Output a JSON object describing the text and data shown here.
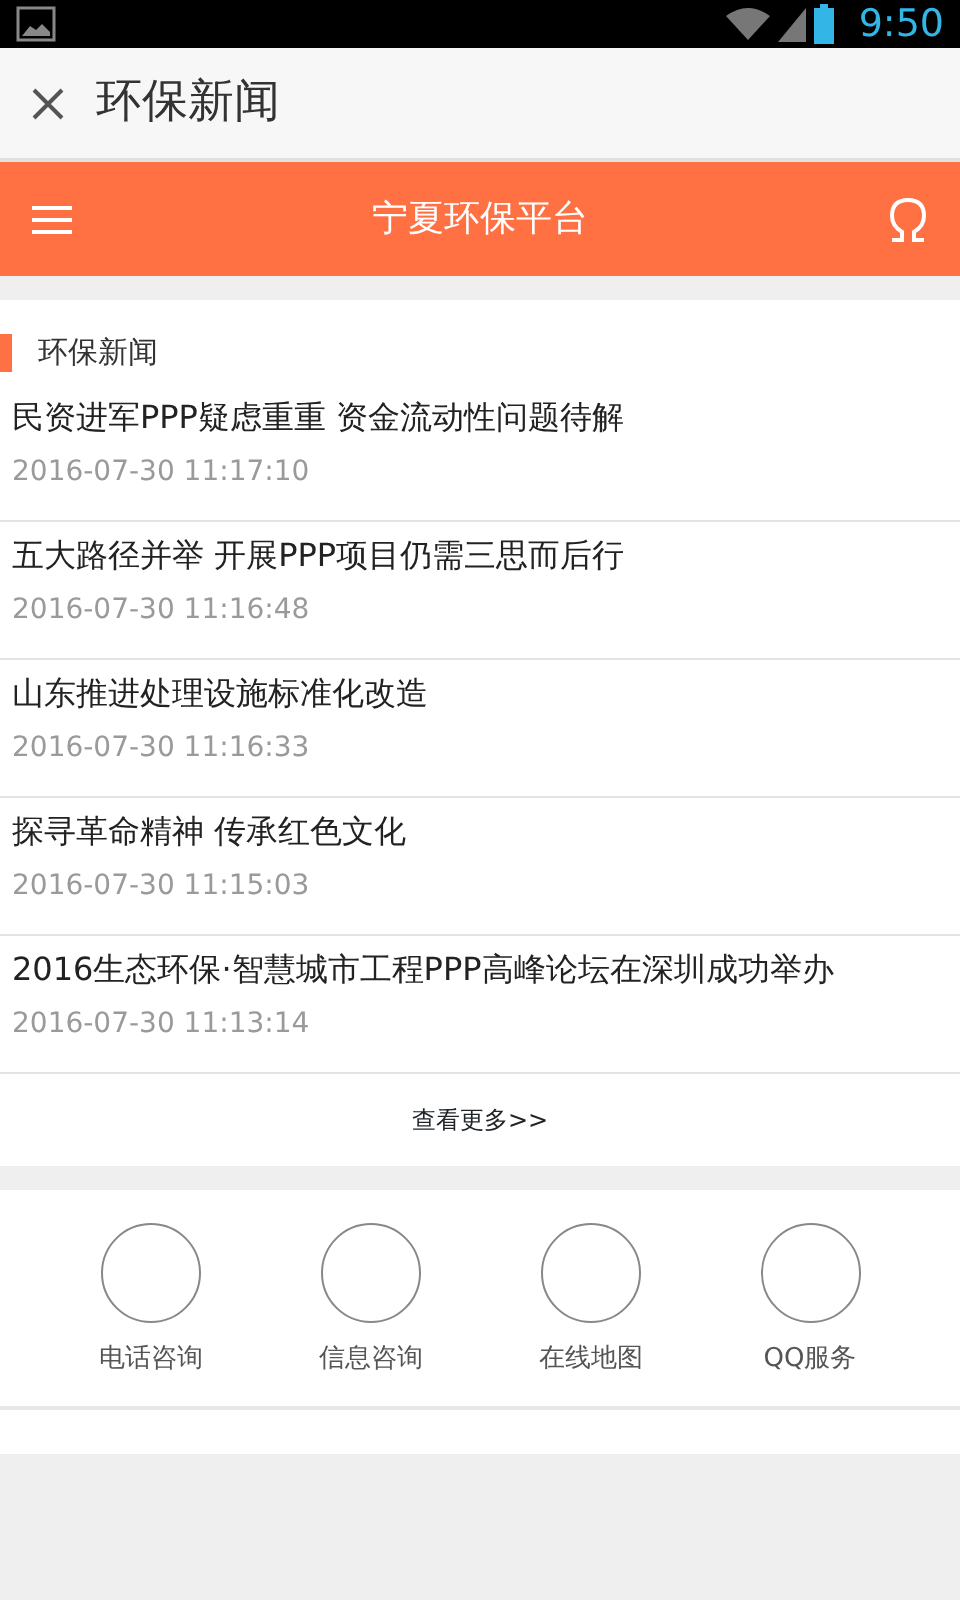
{
  "status_bar": {
    "time": "9:50"
  },
  "app_bar": {
    "title": "环保新闻"
  },
  "header": {
    "title": "宁夏环保平台"
  },
  "news": {
    "heading": "环保新闻",
    "items": [
      {
        "title": "民资进军PPP疑虑重重 资金流动性问题待解",
        "date": "2016-07-30 11:17:10"
      },
      {
        "title": "五大路径并举 开展PPP项目仍需三思而后行",
        "date": "2016-07-30 11:16:48"
      },
      {
        "title": "山东推进处理设施标准化改造",
        "date": "2016-07-30 11:16:33"
      },
      {
        "title": "探寻革命精神 传承红色文化",
        "date": "2016-07-30 11:15:03"
      },
      {
        "title": "2016生态环保·智慧城市工程PPP高峰论坛在深圳成功举办",
        "date": "2016-07-30 11:13:14"
      }
    ],
    "more": "查看更多>>"
  },
  "services": [
    {
      "label": "电话咨询"
    },
    {
      "label": "信息咨询"
    },
    {
      "label": "在线地图"
    },
    {
      "label": "QQ服务"
    }
  ]
}
